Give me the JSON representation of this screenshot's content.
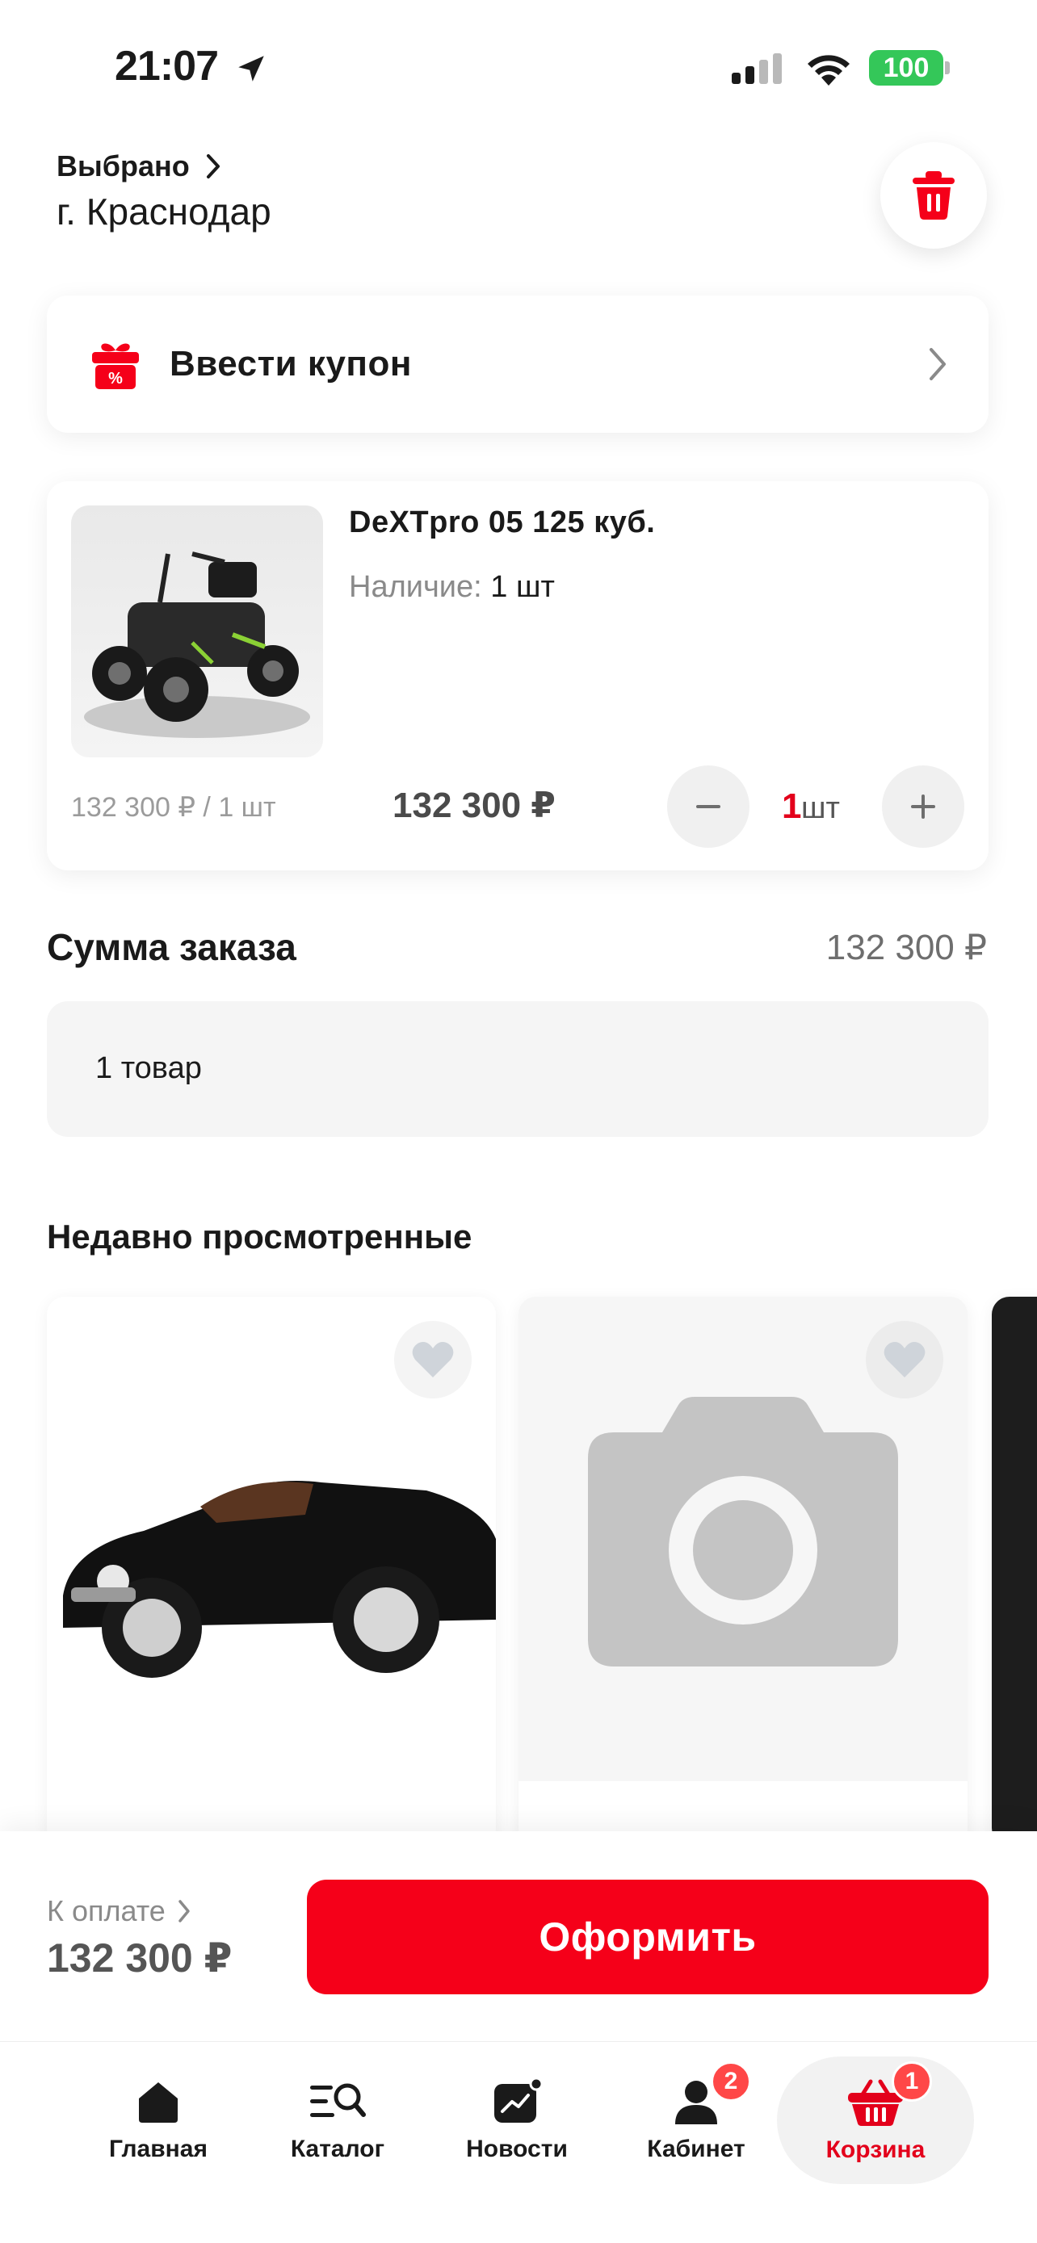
{
  "status_bar": {
    "time": "21:07",
    "battery": "100"
  },
  "header": {
    "location_label": "Выбрано",
    "city": "г. Краснодар"
  },
  "coupon": {
    "label": "Ввести купон"
  },
  "cart_item": {
    "name": "DeXTpro 05 125 куб.",
    "stock_label": "Наличие:",
    "stock_value": "1 шт",
    "unit_price": "132 300 ₽ / 1 шт",
    "price": "132 300 ₽",
    "qty": "1",
    "qty_unit": "шт"
  },
  "summary": {
    "title": "Сумма заказа",
    "total": "132 300 ₽",
    "items_count": "1 товар"
  },
  "recent": {
    "title": "Недавно просмотренные"
  },
  "checkout": {
    "pay_label": "К оплате",
    "pay_total": "132 300 ₽",
    "button_label": "Оформить"
  },
  "tabs": [
    {
      "label": "Главная",
      "icon": "home-icon"
    },
    {
      "label": "Каталог",
      "icon": "catalog-search-icon"
    },
    {
      "label": "Новости",
      "icon": "news-icon"
    },
    {
      "label": "Кабинет",
      "icon": "user-icon",
      "badge": "2"
    },
    {
      "label": "Корзина",
      "icon": "basket-icon",
      "badge": "1",
      "active": true
    }
  ],
  "colors": {
    "accent": "#f50019",
    "active_tab": "#e3001b",
    "badge": "#ff4747",
    "battery": "#34c759"
  }
}
